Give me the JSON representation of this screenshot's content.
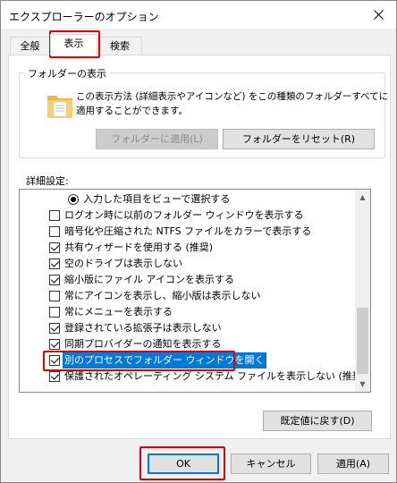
{
  "window": {
    "title": "エクスプローラーのオプション"
  },
  "tabs": [
    {
      "label": "全般"
    },
    {
      "label": "表示"
    },
    {
      "label": "検索"
    }
  ],
  "folder_view": {
    "group_label": "フォルダーの表示",
    "description_line1": "この表示方法 (詳細表示やアイコンなど) をこの種類のフォルダーすべてに",
    "description_line2": "適用することができます。",
    "apply_button": "フォルダーに適用(L)",
    "reset_button": "フォルダーをリセット(R)"
  },
  "advanced": {
    "label": "詳細設定:",
    "items": [
      {
        "type": "radio",
        "checked": true,
        "label": "入力した項目をビューで選択する"
      },
      {
        "type": "checkbox",
        "checked": false,
        "label": "ログオン時に以前のフォルダー ウィンドウを表示する"
      },
      {
        "type": "checkbox",
        "checked": false,
        "label": "暗号化や圧縮された NTFS ファイルをカラーで表示する"
      },
      {
        "type": "checkbox",
        "checked": true,
        "label": "共有ウィザードを使用する (推奨)"
      },
      {
        "type": "checkbox",
        "checked": true,
        "label": "空のドライブは表示しない"
      },
      {
        "type": "checkbox",
        "checked": true,
        "label": "縮小版にファイル アイコンを表示する"
      },
      {
        "type": "checkbox",
        "checked": false,
        "label": "常にアイコンを表示し、縮小版は表示しない"
      },
      {
        "type": "checkbox",
        "checked": false,
        "label": "常にメニューを表示する"
      },
      {
        "type": "checkbox",
        "checked": true,
        "label": "登録されている拡張子は表示しない"
      },
      {
        "type": "checkbox",
        "checked": true,
        "label": "同期プロバイダーの通知を表示する"
      },
      {
        "type": "checkbox",
        "checked": true,
        "label": "別のプロセスでフォルダー ウィンドウを開く",
        "selected": true
      },
      {
        "type": "checkbox",
        "checked": true,
        "label": "保護されたオペレーティング システム ファイルを表示しない (推奨)"
      }
    ],
    "restore_defaults_button": "既定値に戻す(D)"
  },
  "footer": {
    "ok": "OK",
    "cancel": "キャンセル",
    "apply": "適用(A)"
  },
  "colors": {
    "highlight": "#e00000",
    "selection": "#0078d7"
  }
}
